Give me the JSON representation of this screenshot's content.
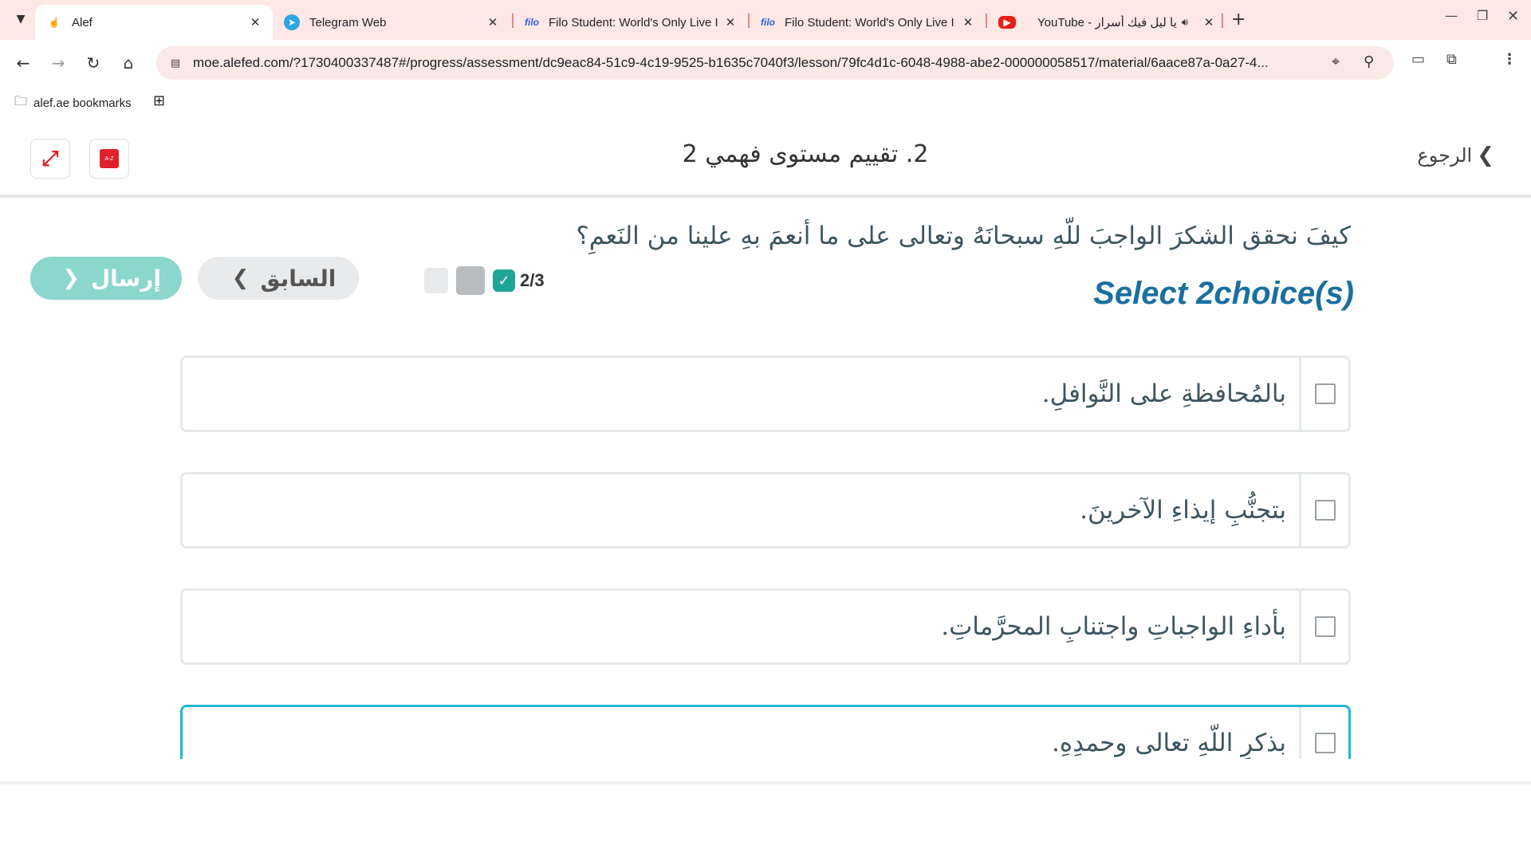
{
  "browser": {
    "tabs": [
      {
        "title": "Alef",
        "favicon": "hand-pointer-icon",
        "active": true
      },
      {
        "title": "Telegram Web",
        "favicon": "telegram-icon"
      },
      {
        "title": "Filo Student: World's Only Live I",
        "favicon": "filo-icon",
        "favicon_text": "filo"
      },
      {
        "title": "Filo Student: World's Only Live I",
        "favicon": "filo-icon",
        "favicon_text": "filo"
      },
      {
        "title": "YouTube - يا ليل فيك أسرار",
        "favicon": "youtube-icon",
        "audio": true
      }
    ],
    "url": "moe.alefed.com/?1730400337487#/progress/assessment/dc9eac84-51c9-4c19-9525-b1635c7040f3/lesson/79fc4d1c-6048-4988-abe2-000000058517/material/6aace87a-0a27-4...",
    "bookmarks": [
      {
        "label": "alef.ae bookmarks"
      }
    ]
  },
  "header": {
    "title": "2. تقييم مستوى فهمي 2",
    "back_label": "الرجوع"
  },
  "question": {
    "text": "كيفَ نحقق الشكرَ الواجبَ للّهِ سبحانَهُ وتعالى على ما أنعمَ بهِ علينا من النَعمِ؟",
    "instruction": "Select 2choice(s)"
  },
  "options": [
    {
      "text": "بالمُحافظةِ على النَّوافلِ.",
      "checked": false
    },
    {
      "text": "بتجنُّبِ إيذاءِ الآخرينَ.",
      "checked": false
    },
    {
      "text": "بأداءِ الواجباتِ واجتنابِ المحرَّماتِ.",
      "checked": false
    },
    {
      "text": "بذكرِ اللّهِ تعالى وحمدِهِ.",
      "checked": false,
      "focused": true
    }
  ],
  "footer": {
    "submit_label": "إرسال",
    "previous_label": "السابق",
    "progress": "2/3"
  },
  "colors": {
    "accent": "#1a6fa0",
    "submit": "#8bd6cd",
    "focus": "#21b7d6",
    "check": "#20a59a",
    "brand_red": "#e0202a"
  }
}
